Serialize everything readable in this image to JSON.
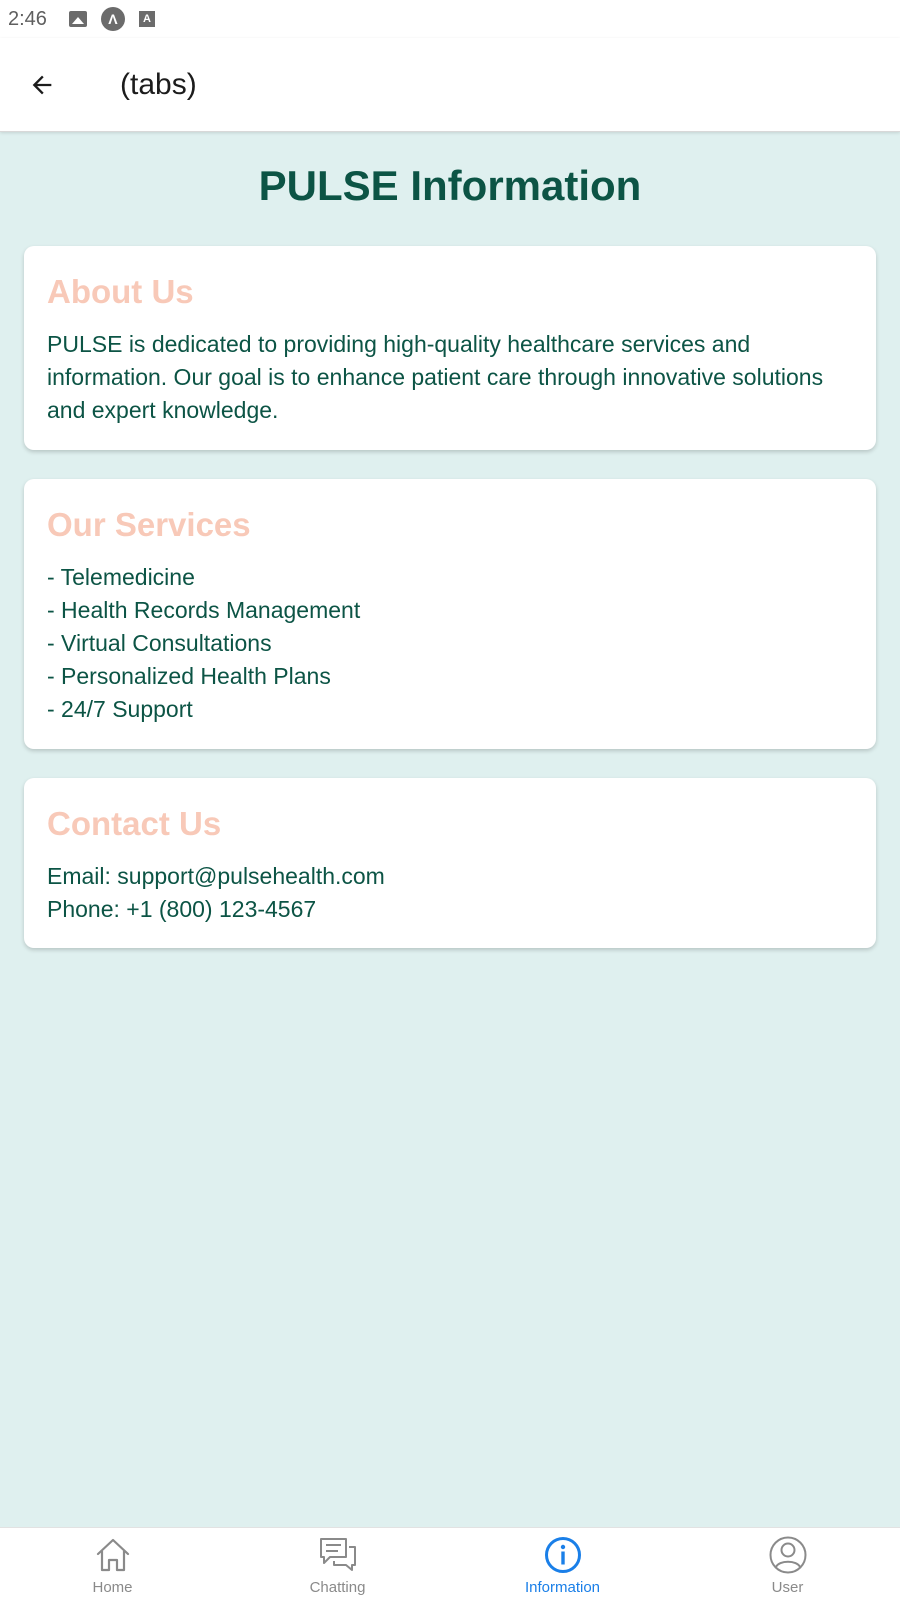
{
  "status_bar": {
    "time": "2:46",
    "icons": [
      "image-icon",
      "a-circle-icon",
      "a-box-icon"
    ]
  },
  "app_bar": {
    "title": "(tabs)",
    "back_icon": "arrow-left-icon"
  },
  "page": {
    "title": "PULSE Information"
  },
  "cards": {
    "about": {
      "heading": "About Us",
      "body": "PULSE is dedicated to providing high-quality healthcare services and information. Our goal is to enhance patient care through innovative solutions and expert knowledge."
    },
    "services": {
      "heading": "Our Services",
      "items": [
        "- Telemedicine",
        "- Health Records Management",
        "- Virtual Consultations",
        "- Personalized Health Plans",
        "- 24/7 Support"
      ]
    },
    "contact": {
      "heading": "Contact Us",
      "email": "Email: support@pulsehealth.com",
      "phone": "Phone: +1 (800) 123-4567"
    }
  },
  "tabs": [
    {
      "label": "Home",
      "icon": "home-icon",
      "active": false
    },
    {
      "label": "Chatting",
      "icon": "chat-icon",
      "active": false
    },
    {
      "label": "Information",
      "icon": "info-icon",
      "active": true
    },
    {
      "label": "User",
      "icon": "user-icon",
      "active": false
    }
  ],
  "colors": {
    "background": "#dff0ef",
    "title": "#0c5445",
    "card_heading": "#f8c9b8",
    "active_tab": "#1a7fe8",
    "inactive_tab": "#8a8a8a"
  }
}
